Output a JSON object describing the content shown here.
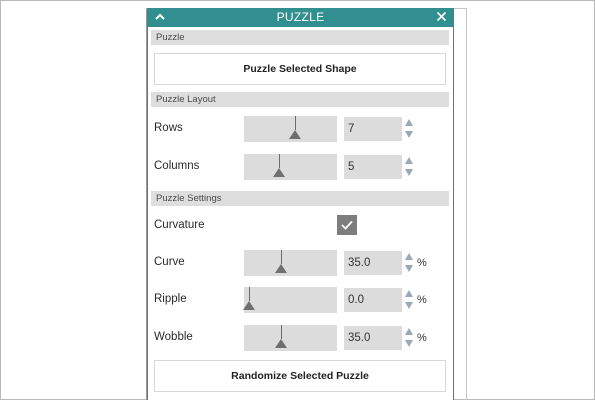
{
  "panel": {
    "title": "PUZZLE",
    "accent_color": "#31908f",
    "header_icons": {
      "collapse": "chevron-up-icon",
      "close": "close-icon"
    }
  },
  "sections": {
    "puzzle": "Puzzle",
    "layout": "Puzzle Layout",
    "settings": "Puzzle Settings"
  },
  "buttons": {
    "puzzle_selected_shape": "Puzzle Selected Shape",
    "randomize_selected_puzzle": "Randomize Selected Puzzle"
  },
  "controls": {
    "rows": {
      "label": "Rows",
      "value": "7",
      "slider_position": 0.55
    },
    "columns": {
      "label": "Columns",
      "value": "5",
      "slider_position": 0.36
    },
    "curvature": {
      "label": "Curvature",
      "checked": true
    },
    "curve": {
      "label": "Curve",
      "value": "35.0",
      "unit": "%",
      "slider_position": 0.38
    },
    "ripple": {
      "label": "Ripple",
      "value": "0.0",
      "unit": "%",
      "slider_position": 0.0
    },
    "wobble": {
      "label": "Wobble",
      "value": "35.0",
      "unit": "%",
      "slider_position": 0.38
    }
  }
}
